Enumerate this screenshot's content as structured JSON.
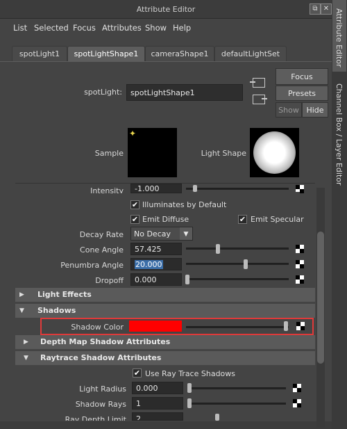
{
  "window": {
    "title": "Attribute Editor",
    "restore_icon": "restore-icon",
    "close_icon": "close-icon"
  },
  "menu": [
    "List",
    "Selected",
    "Focus",
    "Attributes",
    "Show",
    "Help"
  ],
  "tabs": [
    {
      "label": "spotLight1",
      "active": false
    },
    {
      "label": "spotLightShape1",
      "active": true
    },
    {
      "label": "cameraShape1",
      "active": false
    },
    {
      "label": "defaultLightSet",
      "active": false
    }
  ],
  "header": {
    "node_label": "spotLight:",
    "node_name": "spotLightShape1",
    "focus_label": "Focus",
    "presets_label": "Presets",
    "show_label": "Show",
    "hide_label": "Hide",
    "sample_label": "Sample",
    "light_shape_label": "Light Shape"
  },
  "attrs": {
    "intensity_label": "Intensity",
    "intensity_value": "-1.000",
    "illum_default_label": "Illuminates by Default",
    "emit_diffuse_label": "Emit Diffuse",
    "emit_specular_label": "Emit Specular",
    "decay_label": "Decay Rate",
    "decay_value": "No Decay",
    "cone_label": "Cone Angle",
    "cone_value": "57.425",
    "penumbra_label": "Penumbra Angle",
    "penumbra_value": "20.000",
    "dropoff_label": "Dropoff",
    "dropoff_value": "0.000"
  },
  "sections": {
    "light_effects": "Light Effects",
    "shadows": "Shadows",
    "shadow_color_label": "Shadow Color",
    "shadow_color": "#ff0000",
    "depth_map": "Depth Map Shadow Attributes",
    "raytrace": "Raytrace Shadow Attributes",
    "use_ray_trace_label": "Use Ray Trace Shadows",
    "light_radius_label": "Light Radius",
    "light_radius_value": "0.000",
    "shadow_rays_label": "Shadow Rays",
    "shadow_rays_value": "1",
    "ray_depth_label": "Ray Depth Limit",
    "ray_depth_value": "2"
  },
  "side_tabs": {
    "attribute_editor": "Attribute Editor",
    "channel_box": "Channel Box / Layer Editor"
  },
  "colors": {
    "highlight_border": "#e03a3a",
    "accent_text_bg": "#3b6ea8"
  }
}
